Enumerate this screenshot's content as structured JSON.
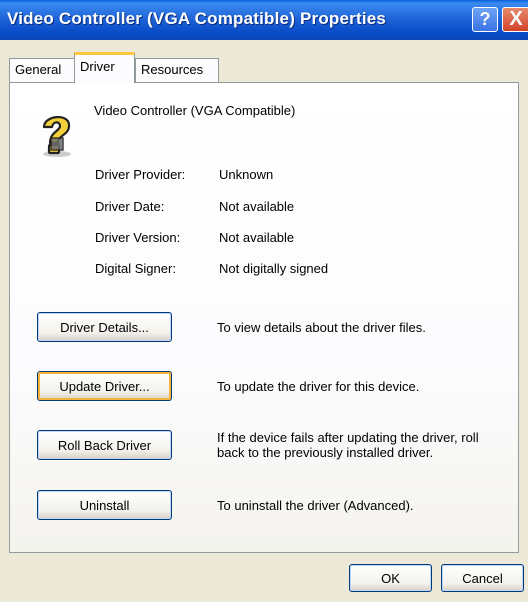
{
  "window": {
    "title": "Video Controller (VGA Compatible) Properties",
    "help_label": "?",
    "close_label": "X"
  },
  "tabs": [
    {
      "label": "General",
      "selected": false
    },
    {
      "label": "Driver",
      "selected": true
    },
    {
      "label": "Resources",
      "selected": false
    }
  ],
  "device": {
    "icon": "unknown-device-question-icon",
    "name": "Video Controller (VGA Compatible)"
  },
  "properties": [
    {
      "label": "Driver Provider:",
      "value": "Unknown"
    },
    {
      "label": "Driver Date:",
      "value": "Not available"
    },
    {
      "label": "Driver Version:",
      "value": "Not available"
    },
    {
      "label": "Digital Signer:",
      "value": "Not digitally signed"
    }
  ],
  "actions": [
    {
      "button": "Driver Details...",
      "description": "To view details about the driver files."
    },
    {
      "button": "Update Driver...",
      "description": "To update the driver for this device."
    },
    {
      "button": "Roll Back Driver",
      "description": "If the device fails after updating the driver, roll back to the previously installed driver."
    },
    {
      "button": "Uninstall",
      "description": "To uninstall the driver (Advanced)."
    }
  ],
  "footer": {
    "ok_label": "OK",
    "cancel_label": "Cancel"
  },
  "colors": {
    "titlebar": "#0A46B8",
    "dialog_bg": "#ECE9D8",
    "tab_highlight": "#FFC83C",
    "focus_ring": "#F8B33C"
  }
}
